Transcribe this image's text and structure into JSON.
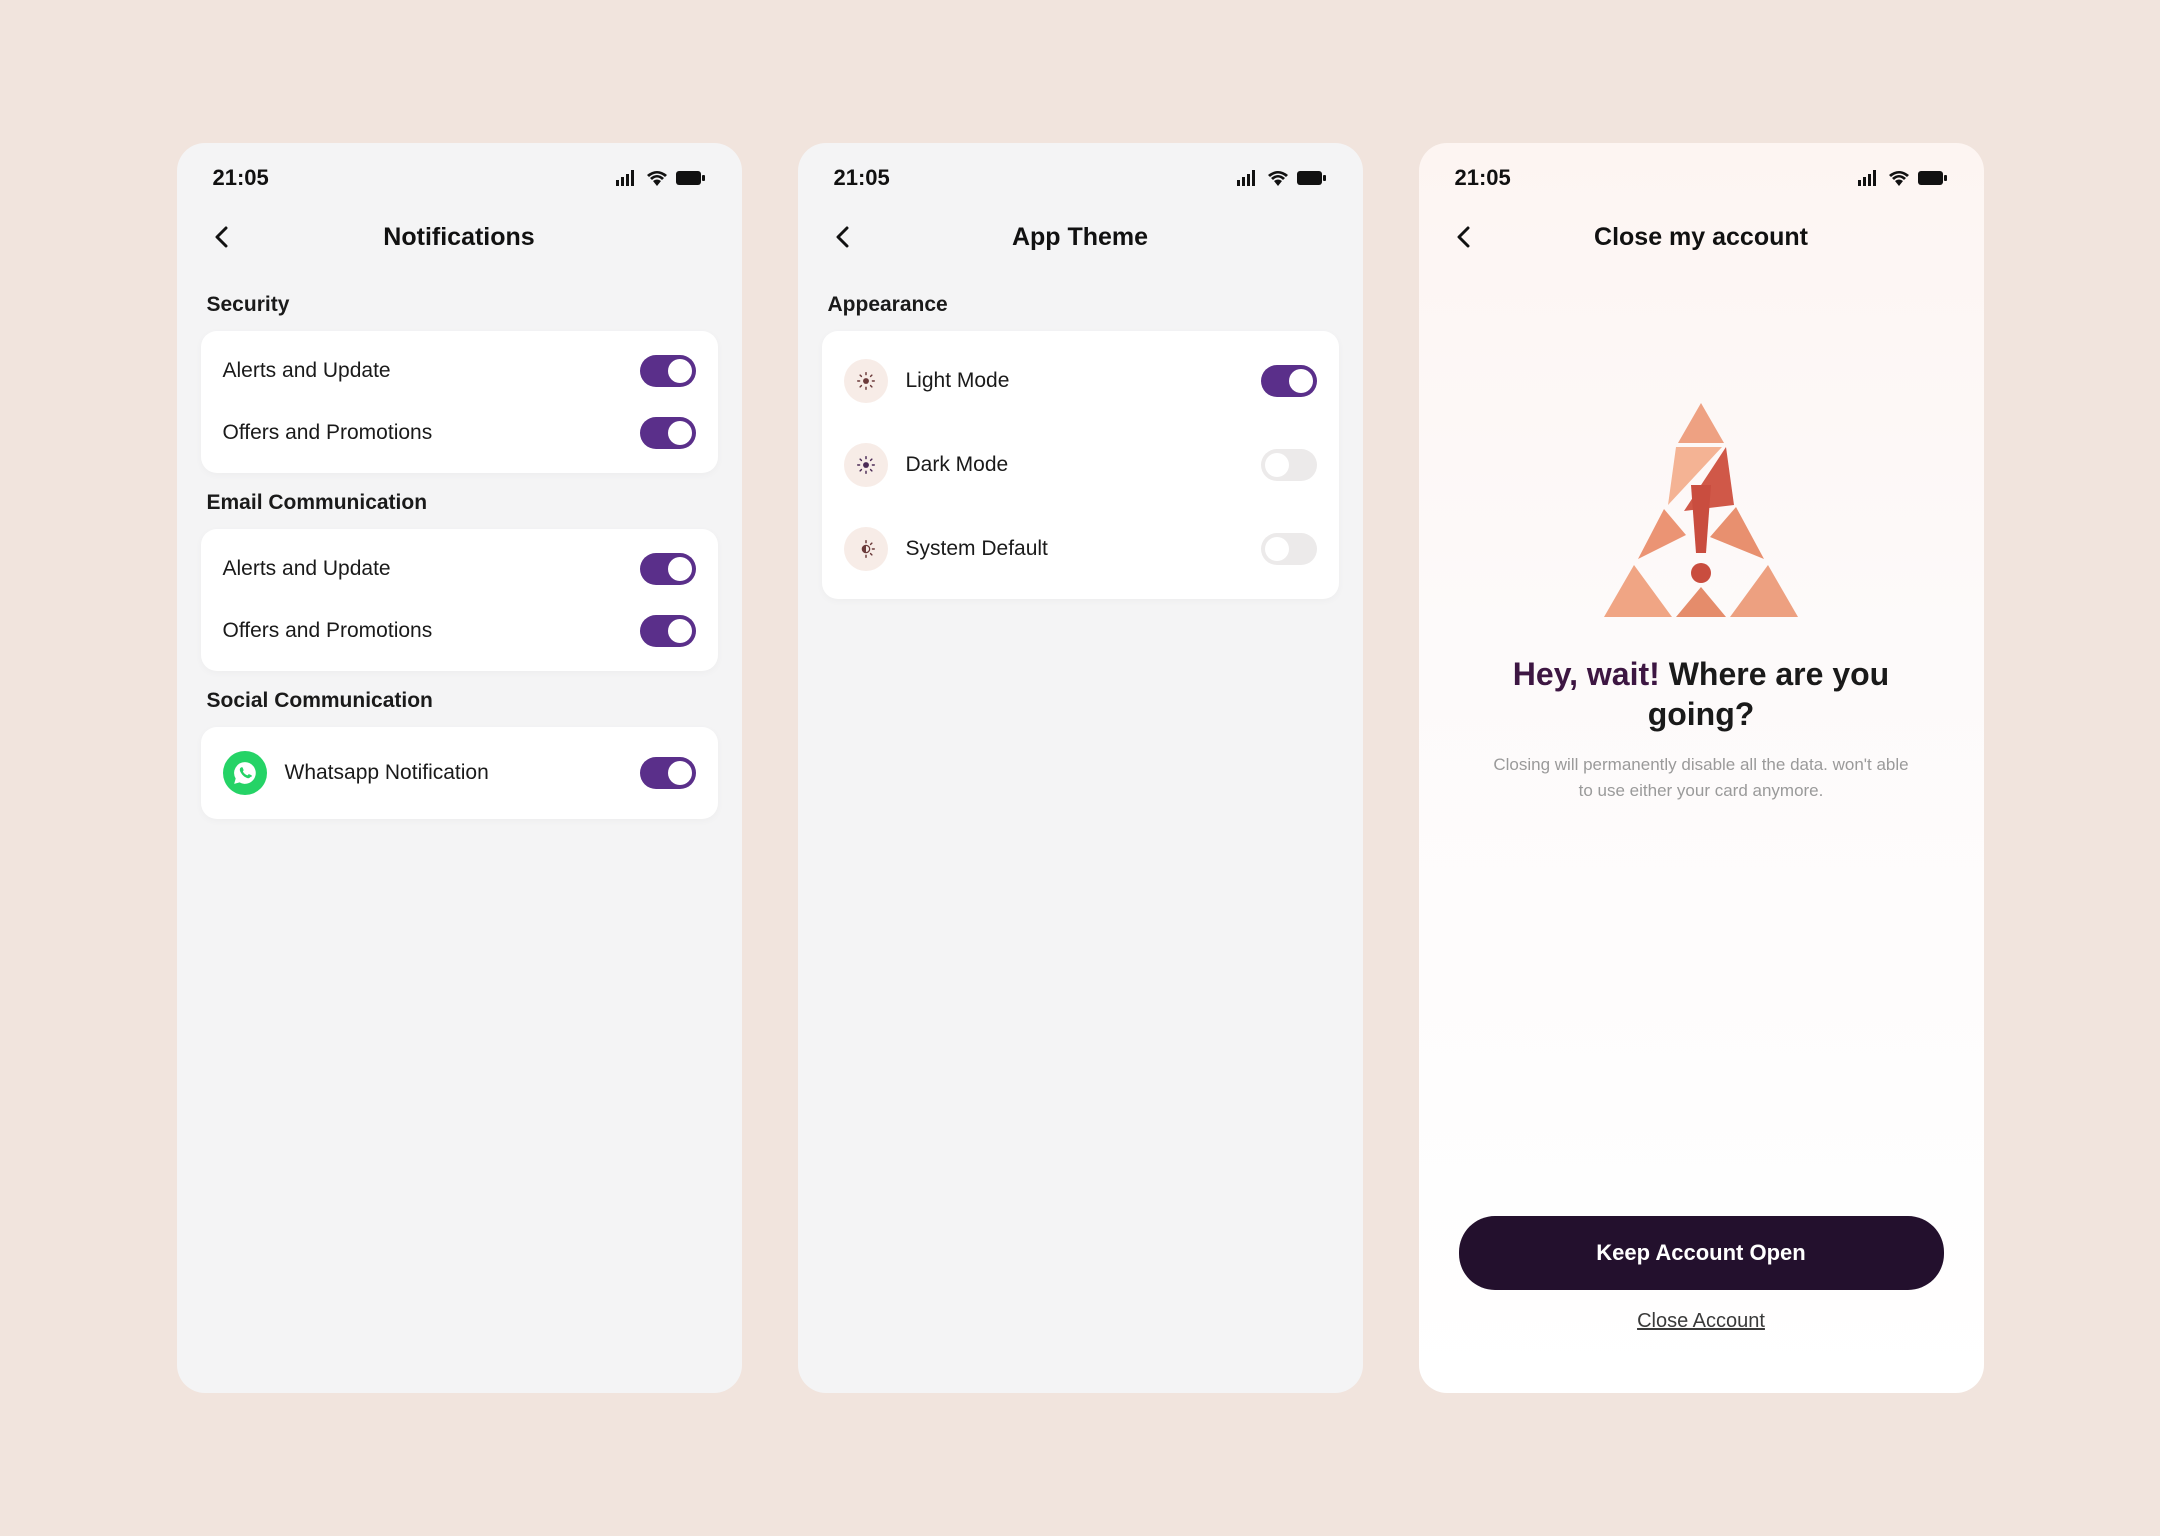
{
  "status_time": "21:05",
  "screens": {
    "notifications": {
      "title": "Notifications",
      "sections": {
        "security": {
          "label": "Security",
          "items": [
            {
              "label": "Alerts and Update",
              "on": true
            },
            {
              "label": "Offers and Promotions",
              "on": true
            }
          ]
        },
        "email": {
          "label": "Email Communication",
          "items": [
            {
              "label": "Alerts and Update",
              "on": true
            },
            {
              "label": "Offers and Promotions",
              "on": true
            }
          ]
        },
        "social": {
          "label": "Social Communication",
          "items": [
            {
              "label": "Whatsapp Notification",
              "on": true
            }
          ]
        }
      }
    },
    "theme": {
      "title": "App Theme",
      "section_label": "Appearance",
      "options": [
        {
          "label": "Light Mode",
          "on": true
        },
        {
          "label": "Dark Mode",
          "on": false
        },
        {
          "label": "System Default",
          "on": false
        }
      ]
    },
    "close": {
      "title": "Close my account",
      "heading_emph": "Hey, wait!",
      "heading_rest": " Where are you going?",
      "subtext": "Closing will permanently disable all the data. won't able to use either your card anymore.",
      "primary_cta": "Keep Account Open",
      "secondary_cta": "Close Account"
    }
  }
}
